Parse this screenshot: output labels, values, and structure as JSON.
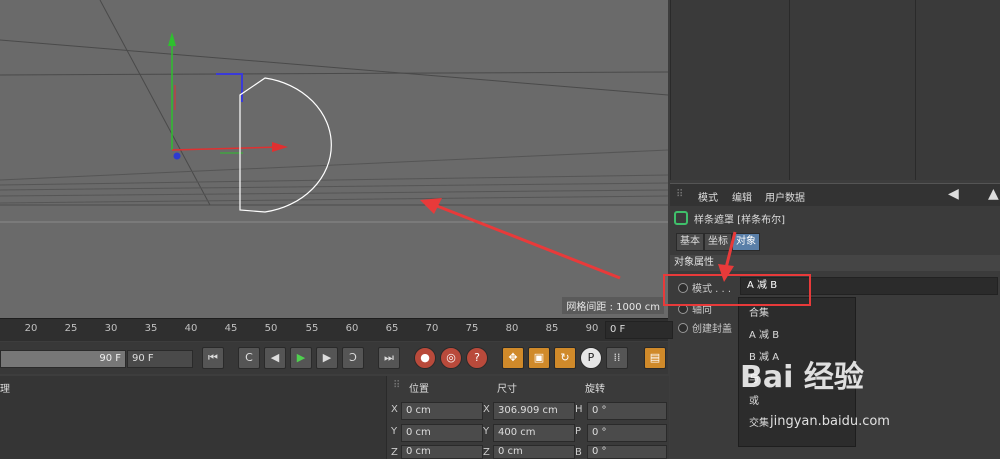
{
  "viewport": {
    "grid_spacing": "网格间距 : 1000 cm"
  },
  "attribute_manager": {
    "menu": [
      "模式",
      "编辑",
      "用户数据"
    ],
    "object_title": "样条遮罩 [样条布尔]",
    "tabs": [
      "基本",
      "坐标",
      "对象"
    ],
    "section": "对象属性",
    "props": {
      "mode_label": "模式 . . .",
      "axis_label": "轴向",
      "create_cap_label": "创建封盖"
    },
    "mode_value": "A 减 B",
    "dropdown_options": [
      "合集",
      "A 减 B",
      "B 减 A",
      "与",
      "或",
      "交集"
    ]
  },
  "timeline": {
    "ticks": [
      "20",
      "25",
      "30",
      "35",
      "40",
      "45",
      "50",
      "55",
      "60",
      "65",
      "70",
      "75",
      "80",
      "85",
      "90"
    ],
    "current_frame": "0 F",
    "end_frame_slider": "90 F",
    "end_frame_field": "90 F"
  },
  "coordinates": {
    "headers": [
      "位置",
      "尺寸",
      "旋转"
    ],
    "rows": [
      {
        "pos_axis": "X",
        "pos": "0 cm",
        "size_axis": "X",
        "size": "306.909 cm",
        "rot_axis": "H",
        "rot": "0 °"
      },
      {
        "pos_axis": "Y",
        "pos": "0 cm",
        "size_axis": "Y",
        "size": "400 cm",
        "rot_axis": "P",
        "rot": "0 °"
      },
      {
        "pos_axis": "Z",
        "pos": "0 cm",
        "size_axis": "Z",
        "size": "0 cm",
        "rot_axis": "B",
        "rot": "0 °"
      }
    ]
  },
  "bottom_left": {
    "label": "理"
  },
  "watermark": {
    "logo": "Bai 经验",
    "url": "jingyan.baidu.com"
  },
  "colors": {
    "annotation": "#e83a3a",
    "tab_active": "#5a7fa8",
    "viewport_bg": "#6a6a6a"
  },
  "icons": [
    "spline-icon",
    "arrow-left-icon",
    "goto-start-icon",
    "prev-key-icon",
    "play-icon",
    "next-key-icon",
    "goto-end-icon",
    "record-icon",
    "move-icon",
    "scale-icon",
    "rotate-icon",
    "p-icon",
    "grid-dots-icon",
    "film-icon"
  ]
}
